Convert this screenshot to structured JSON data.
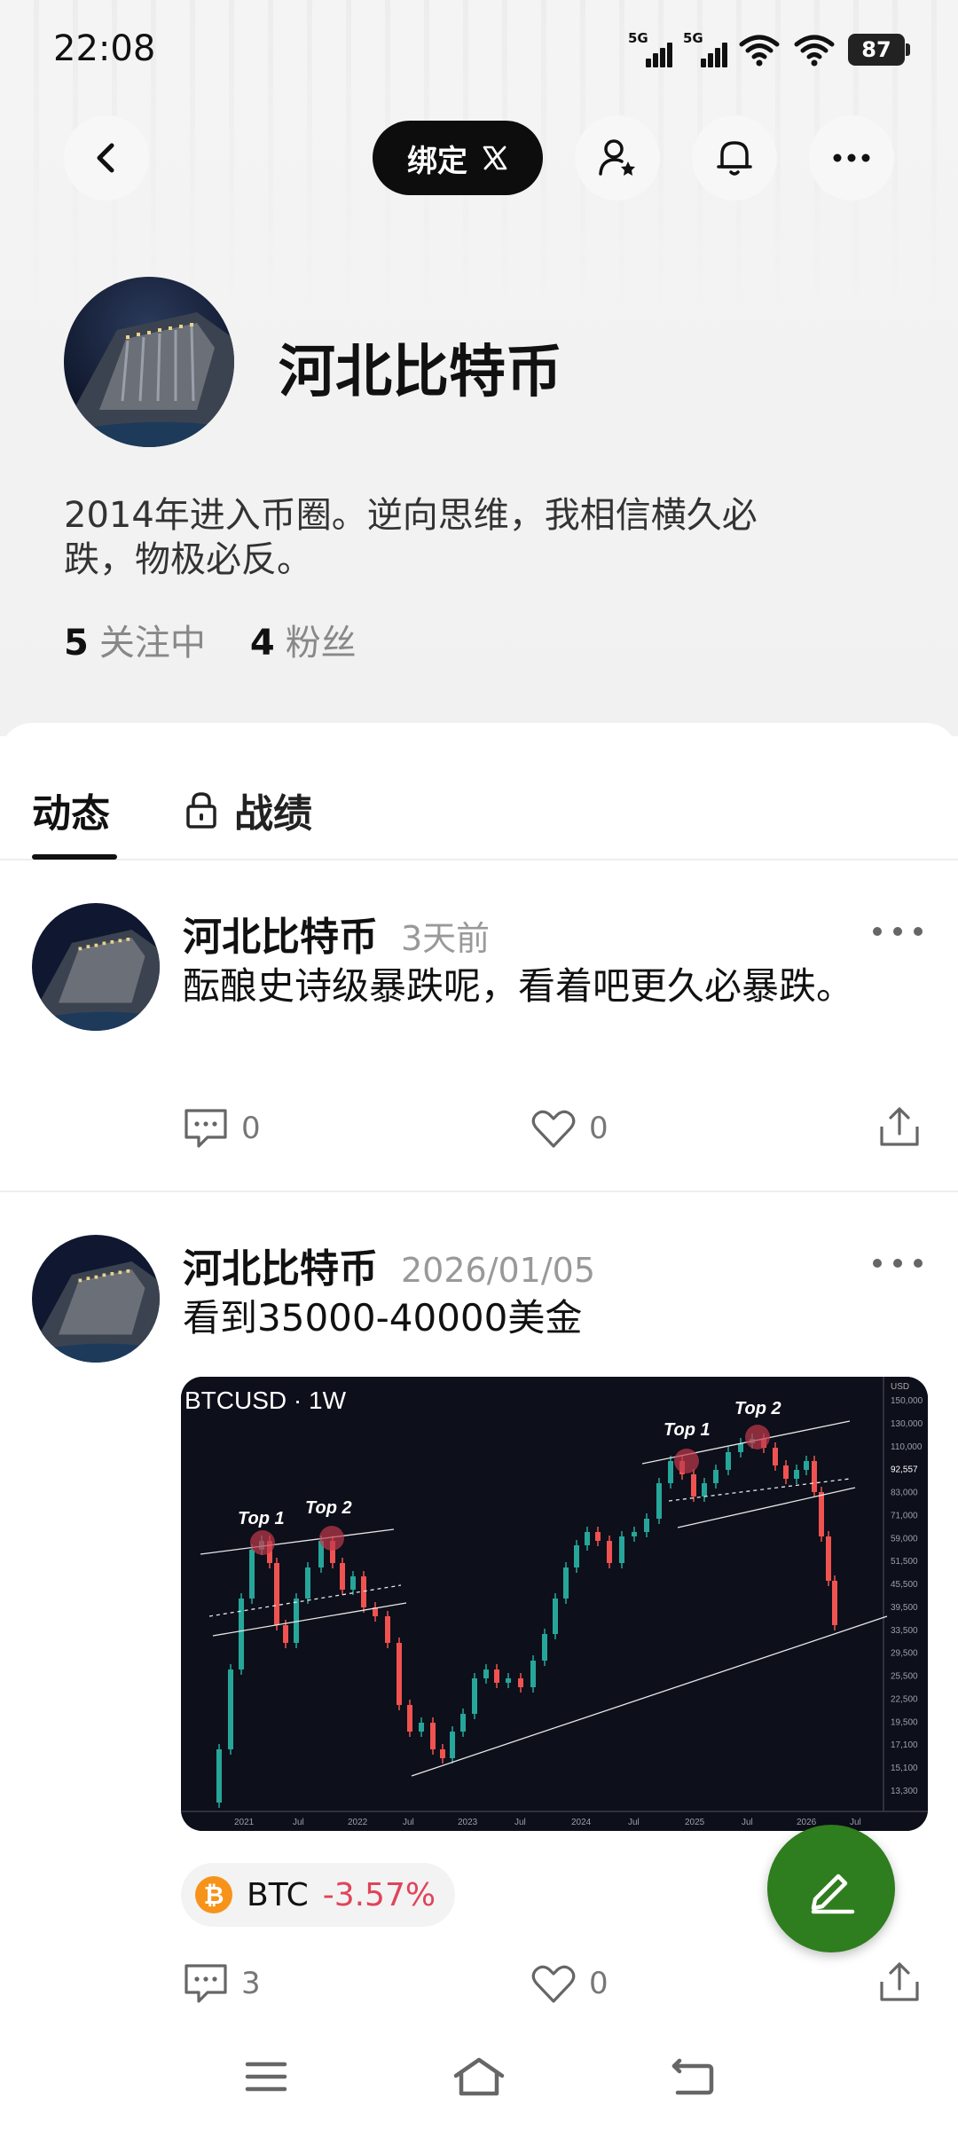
{
  "status_bar": {
    "time": "22:08",
    "signal1": "5G",
    "signal2": "5G",
    "battery": "87"
  },
  "header": {
    "bind_label": "绑定",
    "bind_icon": "x-logo-icon"
  },
  "profile": {
    "name": "河北比特币",
    "bio": "2014年进入币圈。逆向思维，我相信横久必跌，物极必反。",
    "following_count": "5",
    "following_label": "关注中",
    "followers_count": "4",
    "followers_label": "粉丝"
  },
  "tabs": {
    "active": "动态",
    "locked": "战绩"
  },
  "posts": [
    {
      "author": "河北比特币",
      "time": "3天前",
      "text": "酝酿史诗级暴跌呢，看着吧更久必暴跌。",
      "comments": "0",
      "likes": "0"
    },
    {
      "author": "河北比特币",
      "time": "2026/01/05",
      "text": "看到35000-40000美金",
      "comments": "3",
      "likes": "0",
      "image": {
        "title": "BTCUSD · 1W",
        "label_top1": "Top 1",
        "label_top2": "Top 2",
        "currency": "USD",
        "x_ticks": [
          "2021",
          "Jul",
          "2022",
          "Jul",
          "2023",
          "Jul",
          "2024",
          "Jul",
          "2025",
          "Jul",
          "2026",
          "Jul"
        ],
        "y_ticks": [
          "150,000",
          "130,000",
          "110,000",
          "92,557",
          "83,000",
          "71,000",
          "59,000",
          "51,500",
          "45,500",
          "39,500",
          "33,500",
          "29,500",
          "25,500",
          "22,500",
          "19,500",
          "17,100",
          "15,100",
          "13,300"
        ]
      },
      "coin": {
        "symbol": "BTC",
        "change": "-3.57%"
      }
    }
  ],
  "colors": {
    "accent_green": "#2e7d1e",
    "negative_red": "#e0445a",
    "btc_orange": "#f7931a"
  }
}
